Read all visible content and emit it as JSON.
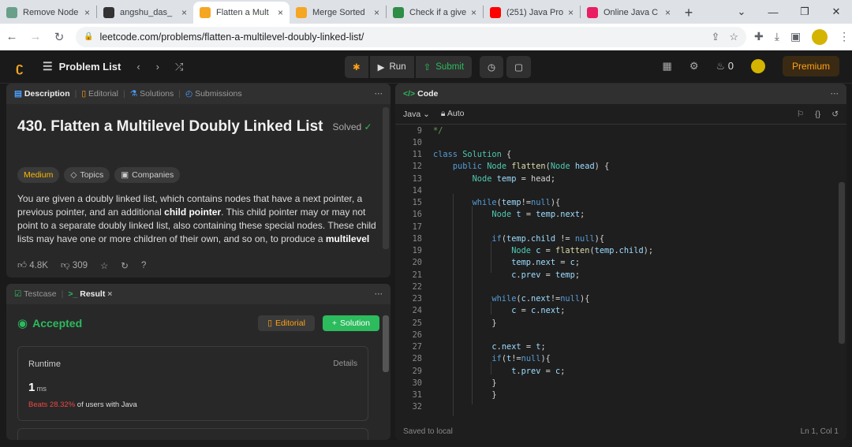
{
  "browser": {
    "tabs": [
      {
        "label": "Remove Node",
        "favicon_color": "#6a9f8a",
        "active": false
      },
      {
        "label": "angshu_das_",
        "favicon_color": "#333333",
        "active": false
      },
      {
        "label": "Flatten a Mult",
        "favicon_color": "#f5a623",
        "active": true
      },
      {
        "label": "Merge Sorted",
        "favicon_color": "#f5a623",
        "active": false
      },
      {
        "label": "Check if a give",
        "favicon_color": "#2f8d46",
        "active": false
      },
      {
        "label": "(251) Java Pro",
        "favicon_color": "#ff0000",
        "active": false
      },
      {
        "label": "Online Java C",
        "favicon_color": "#e91e63",
        "active": false
      }
    ],
    "url": "leetcode.com/problems/flatten-a-multilevel-doubly-linked-list/"
  },
  "appnav": {
    "problem_list": "Problem List",
    "run": "Run",
    "submit": "Submit",
    "streak": "0",
    "premium": "Premium"
  },
  "desc_panel": {
    "tabs": {
      "description": "Description",
      "editorial": "Editorial",
      "solutions": "Solutions",
      "submissions": "Submissions"
    },
    "title": "430. Flatten a Multilevel Doubly Linked List",
    "solved": "Solved",
    "tags": {
      "difficulty": "Medium",
      "topics": "Topics",
      "companies": "Companies"
    },
    "para_1": "You are given a doubly linked list, which contains nodes that have a next pointer, a previous pointer, and an additional ",
    "para_bold_1": "child pointer",
    "para_2": ". This child pointer may or may not point to a separate doubly linked list, also containing these special nodes. These child lists may have one or more children of their own, and so on, to produce a ",
    "para_bold_2": "multilevel",
    "likes": "4.8K",
    "dislikes": "309"
  },
  "result_panel": {
    "testcase_tab": "Testcase",
    "result_tab": "Result",
    "status": "Accepted",
    "editorial_btn": "Editorial",
    "solution_btn": "Solution",
    "runtime_label": "Runtime",
    "details": "Details",
    "runtime_value": "1",
    "runtime_unit": "ms",
    "beats_pct": "Beats 28.32%",
    "beats_rest": "of users with Java"
  },
  "code_panel": {
    "title": "Code",
    "language": "Java",
    "mode": "Auto",
    "saved": "Saved to local",
    "cursor": "Ln 1, Col 1",
    "lines": [
      {
        "n": "9",
        "html": "<span class='cm'>*/</span>"
      },
      {
        "n": "10",
        "html": ""
      },
      {
        "n": "11",
        "html": "<span class='kw'>class</span> <span class='ty'>Solution</span> {"
      },
      {
        "n": "12",
        "html": "    <span class='kw'>public</span> <span class='ty'>Node</span> <span class='fn'>flatten</span>(<span class='ty'>Node</span> <span class='vr'>head</span>) {"
      },
      {
        "n": "13",
        "html": "        <span class='ty'>Node</span> <span class='vr'>temp</span> = head;"
      },
      {
        "n": "14",
        "html": ""
      },
      {
        "n": "15",
        "html": "        <span class='kw'>while</span>(<span class='vr'>temp</span>!=<span class='kw'>null</span>){"
      },
      {
        "n": "16",
        "html": "            <span class='ty'>Node</span> <span class='vr'>t</span> = <span class='vr'>temp</span>.<span class='vr'>next</span>;"
      },
      {
        "n": "17",
        "html": ""
      },
      {
        "n": "18",
        "html": "            <span class='kw'>if</span>(<span class='vr'>temp</span>.<span class='vr'>child</span> != <span class='kw'>null</span>){"
      },
      {
        "n": "19",
        "html": "                <span class='ty'>Node</span> <span class='vr'>c</span> = <span class='fn'>flatten</span>(<span class='vr'>temp</span>.<span class='vr'>child</span>);"
      },
      {
        "n": "20",
        "html": "                <span class='vr'>temp</span>.<span class='vr'>next</span> = <span class='vr'>c</span>;"
      },
      {
        "n": "21",
        "html": "                <span class='vr'>c</span>.<span class='vr'>prev</span> = <span class='vr'>temp</span>;"
      },
      {
        "n": "22",
        "html": ""
      },
      {
        "n": "23",
        "html": "            <span class='kw'>while</span>(<span class='vr'>c</span>.<span class='vr'>next</span>!=<span class='kw'>null</span>){"
      },
      {
        "n": "24",
        "html": "                <span class='vr'>c</span> = <span class='vr'>c</span>.<span class='vr'>next</span>;"
      },
      {
        "n": "25",
        "html": "            }"
      },
      {
        "n": "26",
        "html": ""
      },
      {
        "n": "27",
        "html": "            <span class='vr'>c</span>.<span class='vr'>next</span> = <span class='vr'>t</span>;"
      },
      {
        "n": "28",
        "html": "            <span class='kw'>if</span>(<span class='vr'>t</span>!=<span class='kw'>null</span>){"
      },
      {
        "n": "29",
        "html": "                <span class='vr'>t</span>.<span class='vr'>prev</span> = <span class='vr'>c</span>;"
      },
      {
        "n": "30",
        "html": "            }"
      },
      {
        "n": "31",
        "html": "            }"
      },
      {
        "n": "32",
        "html": ""
      }
    ]
  }
}
